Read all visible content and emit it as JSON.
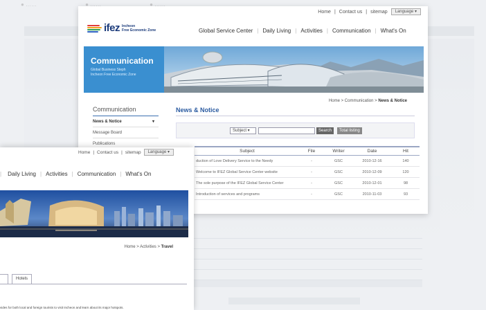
{
  "main_window": {
    "util_links": [
      "Home",
      "Contact us",
      "sitemap"
    ],
    "language_select": "Language",
    "logo_text": "ifez",
    "logo_sub": [
      "Incheon",
      "Free Economic Zone"
    ],
    "gnb": [
      "Global Service Center",
      "Daily Living",
      "Activities",
      "Communication",
      "What's On"
    ],
    "visual_title": "Communication",
    "visual_sub": [
      "Global Business Steph",
      "Incheon Free Economic Zone"
    ],
    "breadcrumb": {
      "path": "Home > Communication > ",
      "current": "News & Notice"
    },
    "lnb": {
      "title": "Communication",
      "items": [
        "News & Notice",
        "Message Board",
        "Publications"
      ]
    },
    "content_title": "News & Notice",
    "search": {
      "select": "Subject",
      "search_btn": "Search",
      "all_btn": "Total listing"
    },
    "table": {
      "headers": [
        "Subject",
        "File",
        "Writer",
        "Date",
        "Hit"
      ],
      "rows": [
        [
          "duction of Love Delivery Service to the Needy",
          "-",
          "GSC",
          "2010-12-16",
          "140"
        ],
        [
          "Welcome to IFEZ Global Service Center website",
          "-",
          "GSC",
          "2010-12-09",
          "120"
        ],
        [
          "The sole purpose of the IFEZ Global Service Center",
          "-",
          "GSC",
          "2010-12-01",
          "98"
        ],
        [
          "Introduction of services and programs",
          "-",
          "GSC",
          "2010-11-03",
          "93"
        ]
      ]
    }
  },
  "front_window": {
    "util_links": [
      "Home",
      "Contact us",
      "sitemap"
    ],
    "language_select": "Language",
    "gnb": [
      "Daily Living",
      "Activities",
      "Communication",
      "What's On"
    ],
    "breadcrumb": {
      "path": "Home > Activities > ",
      "current": "Travel"
    },
    "tabs": [
      "",
      "Hotels"
    ],
    "description": "vides for both local and foreign tourists to visit Incheon and learn about its major hotspots."
  }
}
